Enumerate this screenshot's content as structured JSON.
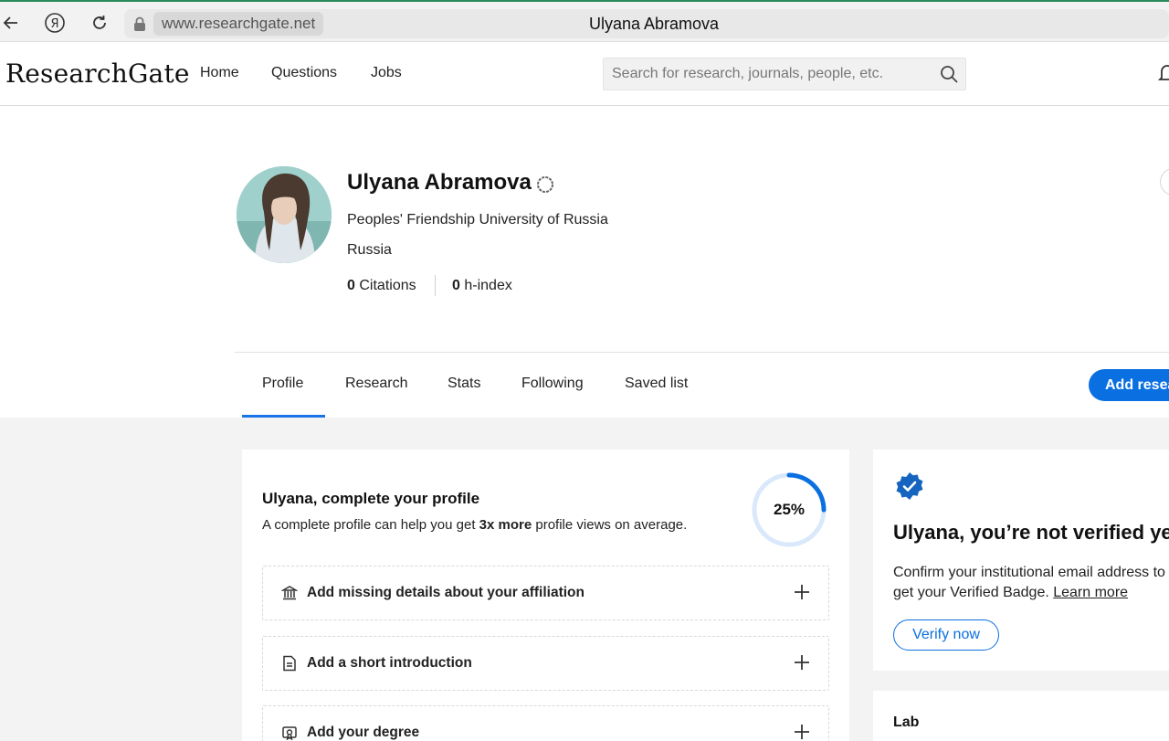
{
  "browser": {
    "url": "www.researchgate.net",
    "tab_title": "Ulyana Abramova"
  },
  "header": {
    "logo": "ResearchGate",
    "nav": [
      "Home",
      "Questions",
      "Jobs"
    ],
    "search_placeholder": "Search for research, journals, people, etc."
  },
  "profile": {
    "name": "Ulyana Abramova",
    "institution": "Peoples' Friendship University of Russia",
    "country": "Russia",
    "citations_value": "0",
    "citations_label": "Citations",
    "hindex_value": "0",
    "hindex_label": "h-index"
  },
  "tabs": [
    "Profile",
    "Research",
    "Stats",
    "Following",
    "Saved list"
  ],
  "active_tab": "Profile",
  "add_research_label": "Add resea",
  "completion": {
    "title": "Ulyana, complete your profile",
    "sub_before": "A complete profile can help you get ",
    "sub_bold": "3x more",
    "sub_after": " profile views on average.",
    "percent_label": "25%",
    "percent_value": 25,
    "tasks": [
      {
        "label": "Add missing details about your affiliation",
        "icon": "institution-icon"
      },
      {
        "label": "Add a short introduction",
        "icon": "document-icon"
      },
      {
        "label": "Add your degree",
        "icon": "degree-icon"
      }
    ]
  },
  "verification": {
    "title": "Ulyana, you’re not verified ye",
    "line1": "Confirm your institutional email address to",
    "line2_before": "get your Verified Badge. ",
    "learn_more": "Learn more",
    "button": "Verify now"
  },
  "lab": {
    "title": "Lab"
  },
  "colors": {
    "accent": "#0a6fe0",
    "tab_underline": "#1a73e8",
    "progress_track": "#d9e8fb",
    "verified_badge": "#1565c0"
  }
}
